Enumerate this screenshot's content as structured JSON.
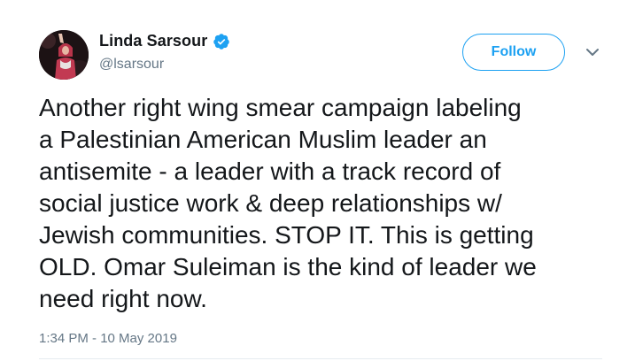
{
  "tweet": {
    "author": {
      "display_name": "Linda Sarsour",
      "handle": "@lsarsour",
      "verified": true,
      "avatar_icon": "profile-photo"
    },
    "follow_label": "Follow",
    "menu_icon": "chevron-down-icon",
    "text": "Another right wing smear campaign labeling\na Palestinian American Muslim leader an\nantisemite - a leader with a track record of\nsocial justice work & deep relationships w/\nJewish communities. STOP IT. This is getting\nOLD. Omar Suleiman is the kind of leader we\nneed right now.",
    "timestamp": "1:34 PM - 10 May 2019"
  },
  "colors": {
    "accent": "#1da1f2",
    "text": "#14171a",
    "secondary": "#657786",
    "divider": "#e6ecf0"
  }
}
